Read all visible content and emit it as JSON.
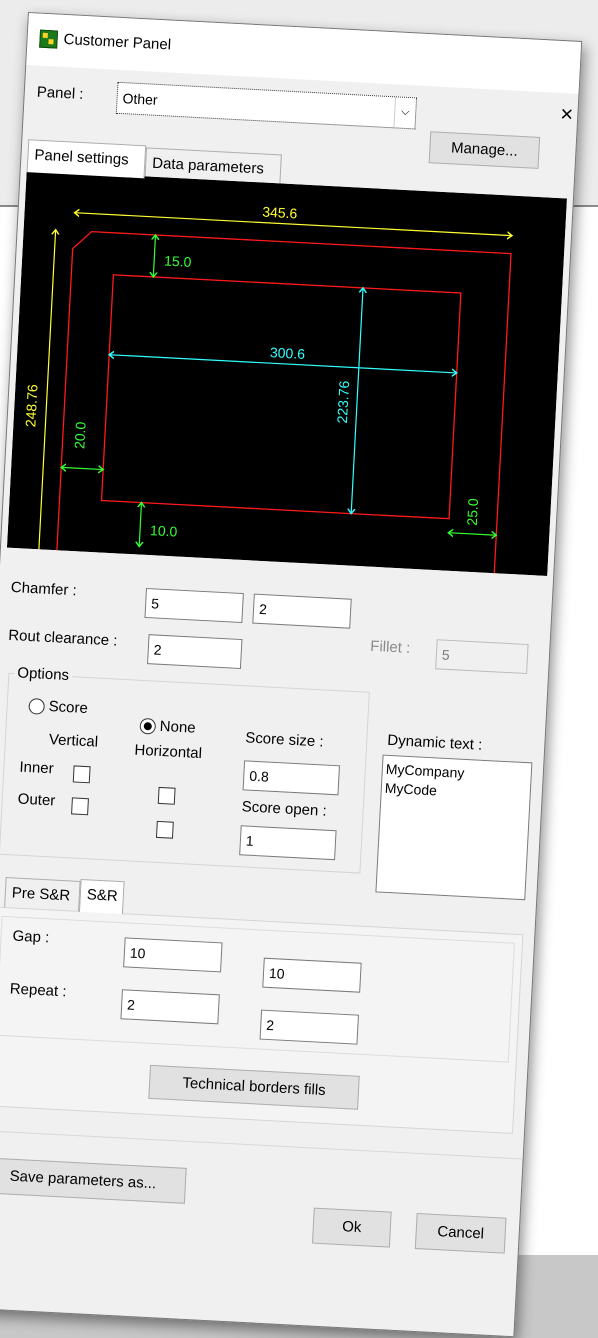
{
  "dialog": {
    "title": "Customer Panel",
    "panel_label": "Panel :",
    "panel_value": "Other",
    "manage_label": "Manage...",
    "tabs": [
      "Panel settings",
      "Data parameters"
    ],
    "active_tab": "Panel settings",
    "close_symbol": "×"
  },
  "diagram": {
    "dimensions": {
      "overall_width": "345.6",
      "overall_height": "248.76",
      "inner_width": "300.6",
      "inner_height": "223.76",
      "margin_top": "15.0",
      "margin_bottom": "10.0",
      "margin_left": "20.0",
      "margin_right": "25.0"
    },
    "colors": {
      "background": "#000000",
      "outline": "#ff1a1a",
      "overall": "#ffff33",
      "inner": "#33ffff",
      "margin": "#33ff33"
    }
  },
  "settings": {
    "chamfer_label": "Chamfer :",
    "chamfer_values": [
      "5",
      "2"
    ],
    "rout_clearance_label": "Rout clearance :",
    "rout_clearance_value": "2",
    "fillet_label": "Fillet :",
    "fillet_value": "5"
  },
  "options": {
    "group_label": "Options",
    "score_label": "Score",
    "none_label": "None",
    "selected": "None",
    "vertical_label": "Vertical",
    "horizontal_label": "Horizontal",
    "inner_label": "Inner",
    "outer_label": "Outer",
    "score_size_label": "Score size :",
    "score_size_value": "0.8",
    "score_open_label": "Score open :",
    "score_open_value": "1"
  },
  "dynamic_text": {
    "label": "Dynamic text :",
    "lines": [
      "MyCompany",
      "MyCode"
    ]
  },
  "sr_tabs": {
    "tabs": [
      "Pre S&R",
      "S&R"
    ],
    "active_tab": "S&R",
    "gap_label": "Gap :",
    "gap_values": [
      "10",
      "10"
    ],
    "repeat_label": "Repeat :",
    "repeat_values": [
      "2",
      "2"
    ],
    "technical_borders_label": "Technical borders fills"
  },
  "footer": {
    "save_label": "Save parameters as...",
    "ok_label": "Ok",
    "cancel_label": "Cancel"
  }
}
